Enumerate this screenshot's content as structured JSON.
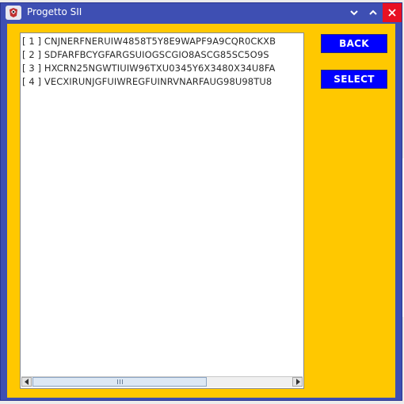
{
  "window": {
    "title": "Progetto SII"
  },
  "list": {
    "items": [
      "[ 1 ] CNJNERFNERUIW4858T5Y8E9WAPF9A9CQR0CKXB",
      "[ 2 ] SDFARFBCYGFARGSUIOGSCGIO8ASCG85SC5O9S",
      "[ 3 ] HXCRN25NGWTIUIW96TXU0345Y6X3480X34U8FA",
      "[ 4 ] VECXIRUNJGFUIWREGFUINRVNARFAUG98U98TU8"
    ],
    "scrollbar_thumb_fraction": 0.62
  },
  "buttons": {
    "back_label": "BACK",
    "select_label": "SELECT"
  },
  "colors": {
    "titlebar": "#3e4fb3",
    "content_bg": "#ffc800",
    "button_bg": "#0000ff",
    "close_bg": "#e81123"
  },
  "icons": {
    "app": "java-app-icon",
    "minimize": "chevron-down-icon",
    "maximize": "chevron-up-icon",
    "close": "close-icon"
  }
}
